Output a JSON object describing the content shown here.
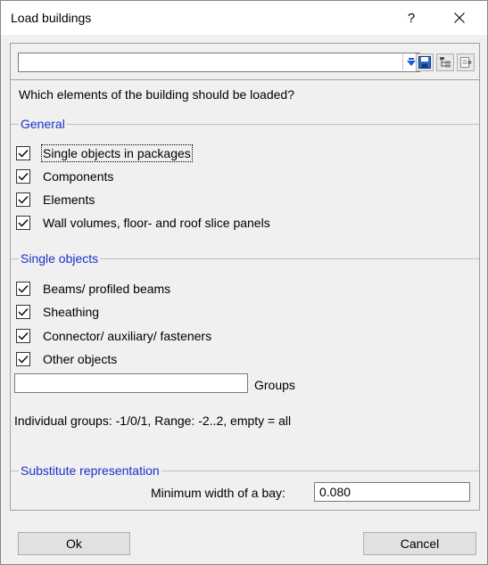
{
  "window": {
    "title": "Load buildings",
    "help_label": "?"
  },
  "preset": {
    "value": ""
  },
  "question": "Which elements of the building should be loaded?",
  "general": {
    "title": "General",
    "items": [
      {
        "label": "Single objects in packages",
        "checked": true
      },
      {
        "label": "Components",
        "checked": true
      },
      {
        "label": "Elements",
        "checked": true
      },
      {
        "label": "Wall volumes, floor- and roof slice panels",
        "checked": true
      }
    ]
  },
  "single_objects": {
    "title": "Single objects",
    "items": [
      {
        "label": "Beams/ profiled beams",
        "checked": true
      },
      {
        "label": "Sheathing",
        "checked": true
      },
      {
        "label": "Connector/ auxiliary/ fasteners",
        "checked": true
      },
      {
        "label": "Other objects",
        "checked": true
      }
    ],
    "groups_value": "",
    "groups_label": "Groups",
    "hint": "Individual groups: -1/0/1, Range: -2..2, empty = all"
  },
  "substitute": {
    "title": "Substitute representation",
    "min_width_label": "Minimum width of a bay:",
    "min_width_value": "0.080"
  },
  "buttons": {
    "ok": "Ok",
    "cancel": "Cancel"
  },
  "icons": {
    "dropdown": "dropdown-arrow-icon",
    "save": "save-icon",
    "tree": "tree-structure-icon",
    "export": "export-icon",
    "close": "close-icon",
    "check": "checkmark-icon"
  },
  "colors": {
    "group_title": "#1a2fc8",
    "accent_blue": "#1a5fc8"
  }
}
